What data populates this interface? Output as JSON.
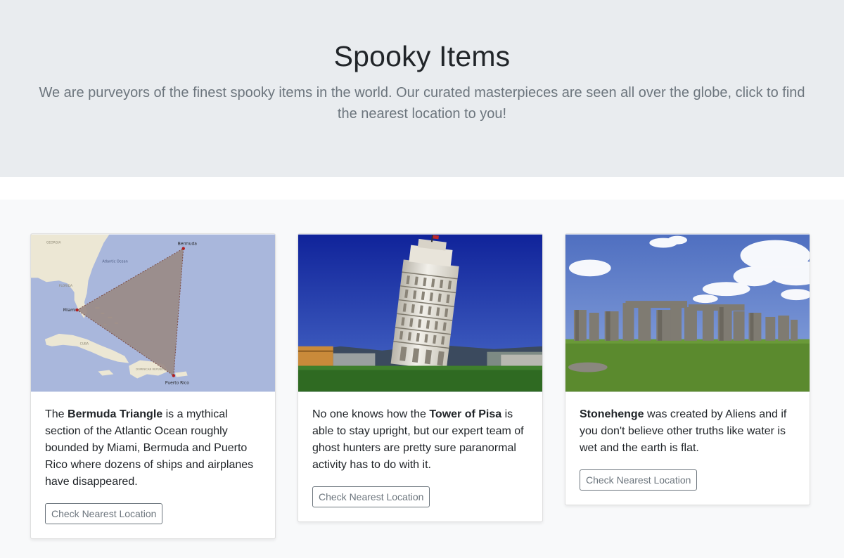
{
  "hero": {
    "title": "Spooky Items",
    "lead": "We are purveyors of the finest spooky items in the world. Our curated masterpieces are seen all over the globe, click to find the nearest location to you!"
  },
  "cards": [
    {
      "image": "bermuda-triangle-map",
      "map_labels": {
        "bermuda": "Bermuda",
        "miami": "Miami",
        "puerto_rico": "Puerto Rico",
        "atlantic": "Atlantic Ocean",
        "florida": "FLORIDA",
        "georgia": "GEORGIA",
        "cuba": "CUBA",
        "dominican": "DOMINICAN REPUBLIC"
      },
      "text_pre": "The ",
      "text_bold": "Bermuda Triangle",
      "text_post": " is a mythical section of the Atlantic Ocean roughly bounded by Miami, Bermuda and Puerto Rico where dozens of ships and airplanes have disappeared.",
      "button": "Check Nearest Location"
    },
    {
      "image": "tower-of-pisa-photo",
      "text_pre": "No one knows how the ",
      "text_bold": "Tower of Pisa",
      "text_post": " is able to stay upright, but our expert team of ghost hunters are pretty sure paranormal activity has to do with it.",
      "button": "Check Nearest Location"
    },
    {
      "image": "stonehenge-photo",
      "text_pre": "",
      "text_bold": "Stonehenge",
      "text_post": " was created by Aliens and if you don't believe other truths like water is wet and the earth is flat.",
      "button": "Check Nearest Location"
    }
  ],
  "colors": {
    "hero_bg": "#e9ecef",
    "album_bg": "#f8f9fa",
    "button_border": "#6c757d",
    "map_sea": "#a9b7dc",
    "map_land": "#ece7d4",
    "triangle_fill": "#9a8a86"
  }
}
